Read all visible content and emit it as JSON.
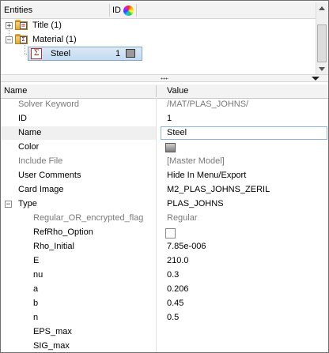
{
  "tree": {
    "header_entities": "Entities",
    "header_id": "ID",
    "items": [
      {
        "label": "Title (1)"
      },
      {
        "label": "Material (1)"
      },
      {
        "label": "Steel",
        "id": "1"
      }
    ]
  },
  "grid": {
    "header_name": "Name",
    "header_value": "Value",
    "rows": [
      {
        "name": "Solver Keyword",
        "value": "/MAT/PLAS_JOHNS/"
      },
      {
        "name": "ID",
        "value": "1"
      },
      {
        "name": "Name",
        "value": "Steel"
      },
      {
        "name": "Color",
        "value": ""
      },
      {
        "name": "Include File",
        "value": "[Master Model]"
      },
      {
        "name": "User Comments",
        "value": "Hide In Menu/Export"
      },
      {
        "name": "Card Image",
        "value": "M2_PLAS_JOHNS_ZERIL"
      },
      {
        "name": "Type",
        "value": "PLAS_JOHNS"
      },
      {
        "name": "Regular_OR_encrypted_flag",
        "value": "Regular"
      },
      {
        "name": "RefRho_Option",
        "value": ""
      },
      {
        "name": "Rho_Initial",
        "value": "7.85e-006"
      },
      {
        "name": "E",
        "value": "210.0"
      },
      {
        "name": "nu",
        "value": "0.3"
      },
      {
        "name": "a",
        "value": "0.206"
      },
      {
        "name": "b",
        "value": "0.45"
      },
      {
        "name": "n",
        "value": "0.5"
      },
      {
        "name": "EPS_max",
        "value": ""
      },
      {
        "name": "SIG_max",
        "value": ""
      }
    ]
  },
  "colors": {
    "selection": "#c3dbf1",
    "material_color": "#9a9a9a",
    "readonly_text": "#7a7a7a"
  }
}
